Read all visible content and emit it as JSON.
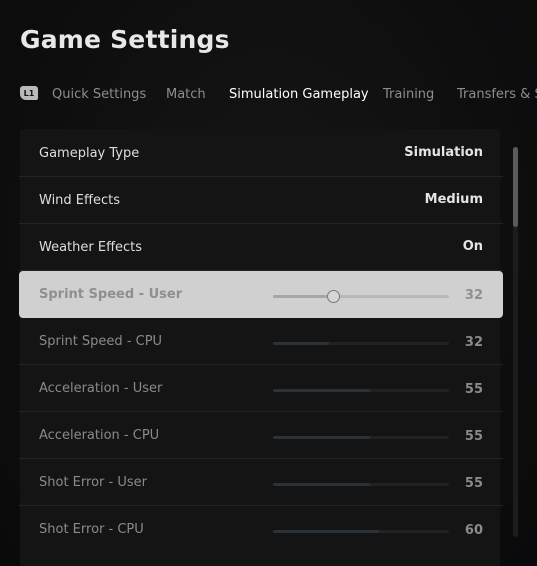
{
  "header": {
    "title": "Game Settings"
  },
  "tabs": {
    "bumper": "L1",
    "items": [
      {
        "label": "Quick Settings"
      },
      {
        "label": "Match"
      },
      {
        "label": "Simulation Gameplay"
      },
      {
        "label": "Training"
      },
      {
        "label": "Transfers & S"
      }
    ],
    "active_index": 2
  },
  "settings": [
    {
      "label": "Gameplay Type",
      "value": "Simulation"
    },
    {
      "label": "Wind Effects",
      "value": "Medium"
    },
    {
      "label": "Weather Effects",
      "value": "On"
    },
    {
      "label": "Sprint Speed - User",
      "value": "32",
      "slider_fraction": 0.34
    },
    {
      "label": "Sprint Speed - CPU",
      "value": "32",
      "slider_fraction": 0.32
    },
    {
      "label": "Acceleration - User",
      "value": "55",
      "slider_fraction": 0.55
    },
    {
      "label": "Acceleration - CPU",
      "value": "55",
      "slider_fraction": 0.55
    },
    {
      "label": "Shot Error - User",
      "value": "55",
      "slider_fraction": 0.55
    },
    {
      "label": "Shot Error - CPU",
      "value": "60",
      "slider_fraction": 0.6
    }
  ],
  "colors": {
    "highlight_row": "#d0d0d0",
    "background": "#0d0d0e"
  }
}
